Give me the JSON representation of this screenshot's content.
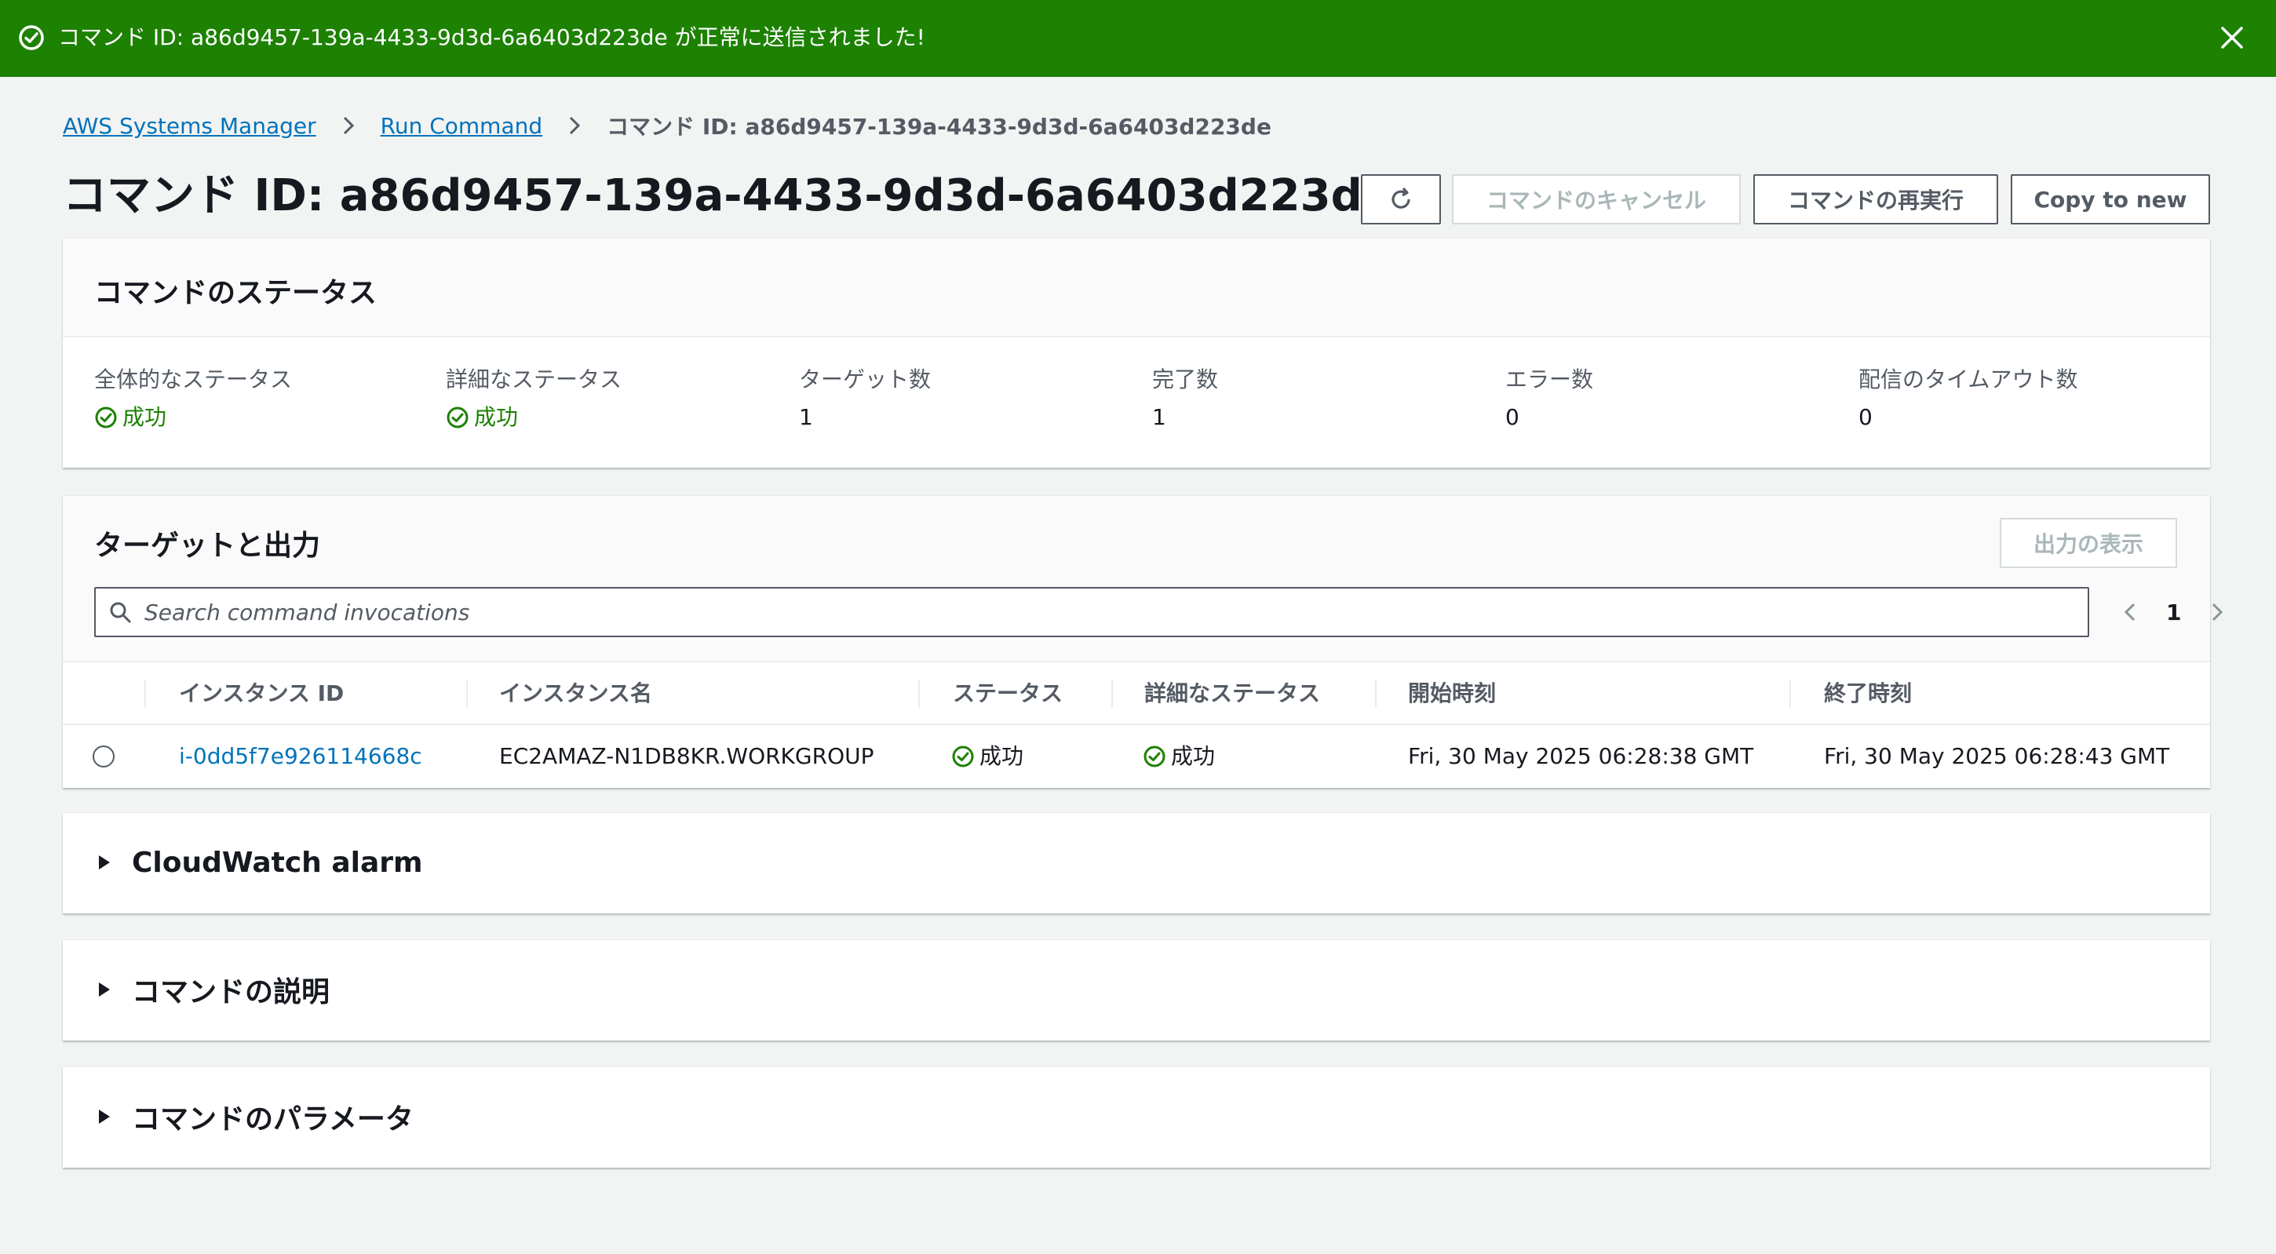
{
  "flash": {
    "message": "コマンド ID: a86d9457-139a-4433-9d3d-6a6403d223de が正常に送信されました!",
    "icon": "success-circle-icon",
    "close_icon": "close-icon",
    "color": "#1d8102"
  },
  "breadcrumb": {
    "items": [
      "AWS Systems Manager",
      "Run Command"
    ],
    "current": "コマンド ID: a86d9457-139a-4433-9d3d-6a6403d223de"
  },
  "header": {
    "title": "コマンド ID: a86d9457-139a-4433-9d3d-6a6403d223de",
    "buttons": {
      "cancel": "コマンドのキャンセル",
      "rerun": "コマンドの再実行",
      "copy": "Copy to new"
    }
  },
  "status": {
    "title": "コマンドのステータス",
    "fields": [
      {
        "label": "全体的なステータス",
        "value": "成功"
      },
      {
        "label": "詳細なステータス",
        "value": "成功"
      },
      {
        "label": "ターゲット数",
        "value": "1"
      },
      {
        "label": "完了数",
        "value": "1"
      },
      {
        "label": "エラー数",
        "value": "0"
      },
      {
        "label": "配信のタイムアウト数",
        "value": "0"
      }
    ]
  },
  "targets": {
    "title": "ターゲットと出力",
    "output_button": "出力の表示",
    "search_placeholder": "Search command invocations",
    "page": "1",
    "columns": [
      "インスタンス ID",
      "インスタンス名",
      "ステータス",
      "詳細なステータス",
      "開始時刻",
      "終了時刻"
    ],
    "rows": [
      {
        "instance_id": "i-0dd5f7e926114668c",
        "instance_name": "EC2AMAZ-N1DB8KR.WORKGROUP",
        "status": "成功",
        "detailed_status": "成功",
        "start": "Fri, 30 May 2025 06:28:38 GMT",
        "end": "Fri, 30 May 2025 06:28:43 GMT"
      }
    ]
  },
  "sections": {
    "cloudwatch": "CloudWatch alarm",
    "description": "コマンドの説明",
    "parameters": "コマンドのパラメータ"
  }
}
